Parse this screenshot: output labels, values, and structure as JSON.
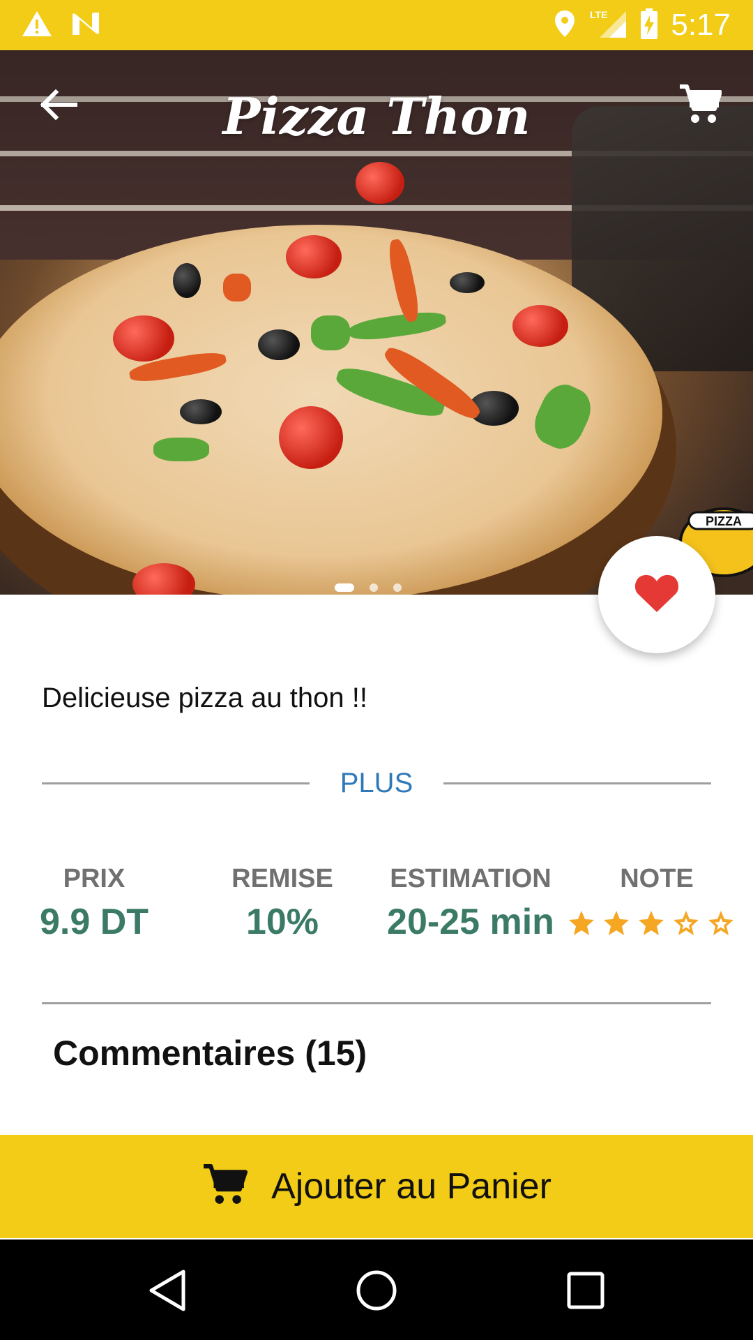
{
  "status_bar": {
    "time": "5:17",
    "background": "#F2CC16",
    "icons": [
      "warning-icon",
      "notification-n-icon",
      "location-icon",
      "lte-signal-icon",
      "battery-charging-icon"
    ],
    "lte_label": "LTE"
  },
  "app_bar": {
    "title": "Pizza Thon",
    "back_icon": "arrow-back-icon",
    "cart_icon": "cart-icon"
  },
  "hero": {
    "image": "pizza-thon-photo",
    "pager": {
      "pages": 3,
      "active_index": 0
    },
    "logo_text": "PIZZA"
  },
  "favorite": {
    "icon": "heart-icon",
    "active": true,
    "color": "#E53935"
  },
  "product": {
    "description": "Delicieuse pizza au thon !!",
    "more_label": "PLUS",
    "stats": {
      "price_label": "PRIX",
      "price_value": "9.9 DT",
      "discount_label": "REMISE",
      "discount_value": "10%",
      "estimation_label": "ESTIMATION",
      "estimation_value": "20-25 min",
      "rating_label": "NOTE",
      "rating_value": 3,
      "rating_max": 5
    },
    "comments_label": "Commentaires (15)"
  },
  "add_to_cart": {
    "label": "Ajouter au Panier",
    "icon": "cart-icon"
  },
  "nav_bar": {
    "buttons": [
      "back-triangle-icon",
      "home-circle-icon",
      "recents-square-icon"
    ]
  },
  "colors": {
    "accent_yellow": "#F2CC16",
    "value_green": "#3a7a66",
    "link_blue": "#2f79b9",
    "star_orange": "#F5A623"
  }
}
